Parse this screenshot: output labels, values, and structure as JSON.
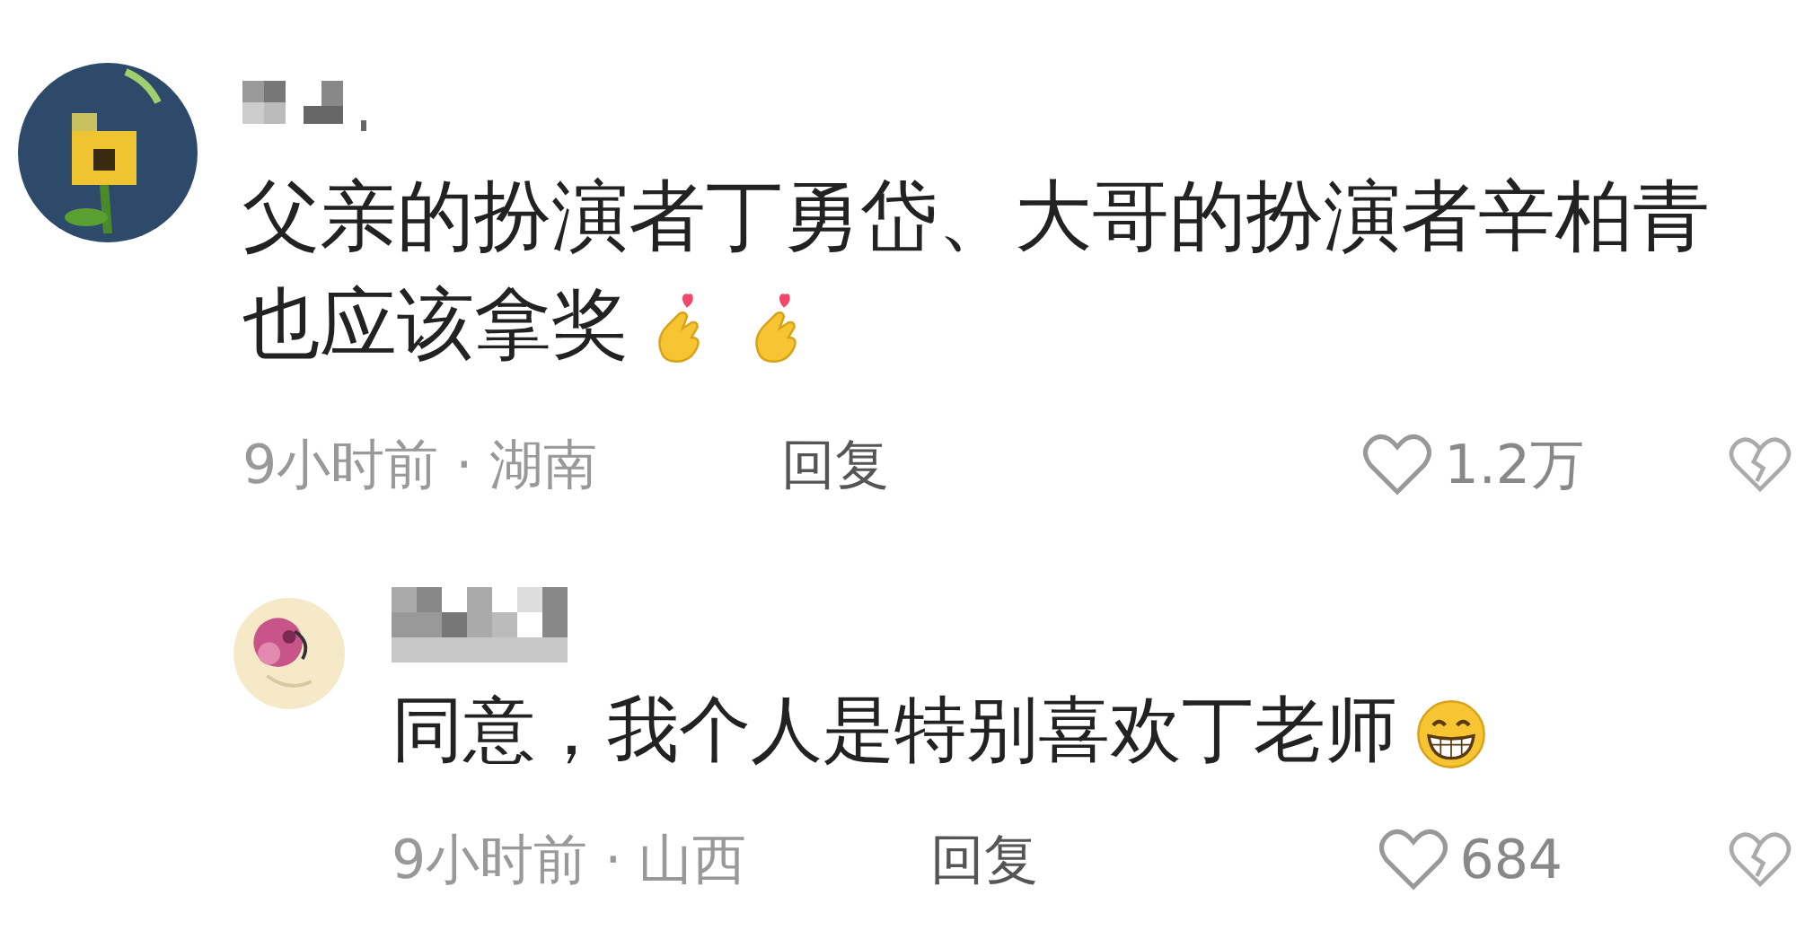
{
  "comments": [
    {
      "avatar": {
        "kind": "picture"
      },
      "text": "父亲的扮演者丁勇岱、大哥的扮演者辛柏青也应该拿奖",
      "emojis": [
        {
          "kind": "finger-heart"
        },
        {
          "kind": "finger-heart"
        }
      ],
      "meta": "9小时前 · 湖南",
      "reply_label": "回复",
      "likes": "1.2万",
      "replies": [
        {
          "avatar": {
            "kind": "picture"
          },
          "text": "同意，我个人是特别喜欢丁老师",
          "emojis": [
            {
              "kind": "grin"
            }
          ],
          "meta": "9小时前 · 山西",
          "reply_label": "回复",
          "likes": "684"
        }
      ]
    }
  ]
}
